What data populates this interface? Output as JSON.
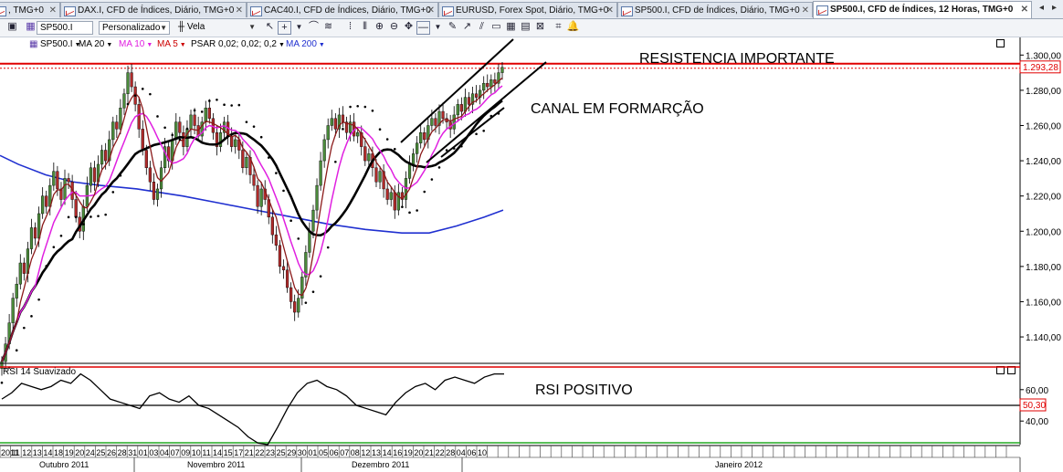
{
  "tabs": [
    {
      "label": ", TMG+0",
      "active": false
    },
    {
      "label": "DAX.I, CFD de Índices, Diário, TMG+0",
      "active": false
    },
    {
      "label": "CAC40.I, CFD de Índices, Diário, TMG+0",
      "active": false
    },
    {
      "label": "EURUSD, Forex Spot, Diário, TMG+0",
      "active": false
    },
    {
      "label": "SP500.I, CFD de Índices, Diário, TMG+0",
      "active": false
    },
    {
      "label": "SP500.I, CFD de Índices, 12 Horas, TMG+0",
      "active": true
    }
  ],
  "toolbar": {
    "symbol": "SP500.I",
    "template": "Personalizado",
    "chart_type": "Vela"
  },
  "indicators": [
    {
      "label": "SP500.I",
      "color": "#000000"
    },
    {
      "label": "MA 20",
      "color": "#000000"
    },
    {
      "label": "MA 10",
      "color": "#e020e0"
    },
    {
      "label": "MA 5",
      "color": "#cc0000"
    },
    {
      "label": "PSAR 0,02; 0,02; 0,2",
      "color": "#000000"
    },
    {
      "label": "MA 200",
      "color": "#2030d0"
    }
  ],
  "annotations": {
    "resistance": "RESISTENCIA IMPORTANTE",
    "channel": "CANAL EM FORMARÇÃO",
    "rsi": "RSI POSITIVO"
  },
  "colors": {
    "up": "#4a8a3a",
    "down": "#b02a2a",
    "ma20": "#000000",
    "ma10": "#e020e0",
    "ma5": "#8b1a1a",
    "ma200": "#2030d0",
    "resistance": "#e00000",
    "last_price_box": "#e00000"
  },
  "chart_data": [
    {
      "type": "candlestick",
      "title": "SP500.I, CFD de Índices, 12 Horas, TMG+0",
      "ylim": [
        1125,
        1310
      ],
      "yticks": [
        "1.300,00",
        "1.280,00",
        "1.260,00",
        "1.240,00",
        "1.220,00",
        "1.200,00",
        "1.180,00",
        "1.160,00",
        "1.140,00"
      ],
      "last_price": "1.293,28",
      "resistance_level": 1293,
      "x_day_labels": [
        "2011",
        "11",
        "12",
        "13",
        "14",
        "18",
        "19",
        "20",
        "24",
        "25",
        "26",
        "28",
        "31",
        "01",
        "03",
        "04",
        "07",
        "09",
        "10",
        "11",
        "14",
        "15",
        "17",
        "21",
        "22",
        "23",
        "25",
        "29",
        "30",
        "01",
        "05",
        "06",
        "07",
        "08",
        "12",
        "13",
        "14",
        "16",
        "19",
        "20",
        "21",
        "22",
        "28",
        "04",
        "06",
        "10"
      ],
      "x_month_labels": [
        "Outubro 2011",
        "Novembro 2011",
        "Dezembro 2011",
        "Janeiro 2012"
      ],
      "closes": [
        1126,
        1136,
        1148,
        1162,
        1170,
        1182,
        1176,
        1190,
        1202,
        1196,
        1210,
        1220,
        1214,
        1226,
        1234,
        1224,
        1218,
        1230,
        1228,
        1218,
        1208,
        1200,
        1214,
        1226,
        1236,
        1228,
        1238,
        1246,
        1240,
        1252,
        1262,
        1258,
        1270,
        1278,
        1290,
        1282,
        1272,
        1258,
        1246,
        1236,
        1228,
        1218,
        1224,
        1236,
        1248,
        1240,
        1252,
        1262,
        1256,
        1248,
        1258,
        1266,
        1260,
        1254,
        1262,
        1270,
        1264,
        1256,
        1248,
        1256,
        1262,
        1254,
        1248,
        1252,
        1246,
        1236,
        1242,
        1232,
        1226,
        1214,
        1224,
        1218,
        1208,
        1198,
        1192,
        1180,
        1178,
        1168,
        1160,
        1154,
        1162,
        1174,
        1188,
        1200,
        1212,
        1226,
        1240,
        1252,
        1260,
        1264,
        1258,
        1266,
        1262,
        1256,
        1262,
        1254,
        1256,
        1248,
        1240,
        1244,
        1236,
        1228,
        1234,
        1224,
        1218,
        1222,
        1212,
        1222,
        1218,
        1230,
        1238,
        1244,
        1250,
        1256,
        1252,
        1260,
        1264,
        1260,
        1268,
        1264,
        1262,
        1258,
        1266,
        1272,
        1268,
        1276,
        1272,
        1278,
        1276,
        1280,
        1284,
        1282,
        1286,
        1284,
        1290,
        1293
      ],
      "ma200": [
        [
          0,
          1243
        ],
        [
          20,
          1238
        ],
        [
          50,
          1232
        ],
        [
          80,
          1228
        ],
        [
          110,
          1226
        ],
        [
          150,
          1224
        ],
        [
          200,
          1220
        ],
        [
          240,
          1216
        ],
        [
          280,
          1212
        ],
        [
          320,
          1208
        ],
        [
          360,
          1204
        ],
        [
          400,
          1201
        ],
        [
          440,
          1199
        ],
        [
          470,
          1199
        ],
        [
          500,
          1203
        ],
        [
          530,
          1208
        ],
        [
          551,
          1212
        ]
      ]
    },
    {
      "type": "line",
      "title": "RSI 14 Suavizado",
      "ylim": [
        25,
        75
      ],
      "yticks": [
        "60,00",
        "40,00"
      ],
      "last_value": "50,30",
      "reference_level": 50,
      "values": [
        54,
        58,
        64,
        62,
        60,
        62,
        66,
        64,
        70,
        66,
        60,
        54,
        52,
        50,
        48,
        56,
        58,
        54,
        52,
        56,
        50,
        48,
        44,
        40,
        36,
        30,
        26,
        25,
        36,
        48,
        58,
        64,
        66,
        62,
        60,
        56,
        50,
        48,
        46,
        44,
        52,
        58,
        62,
        64,
        60,
        66,
        68,
        66,
        64,
        68,
        70,
        70
      ]
    }
  ]
}
